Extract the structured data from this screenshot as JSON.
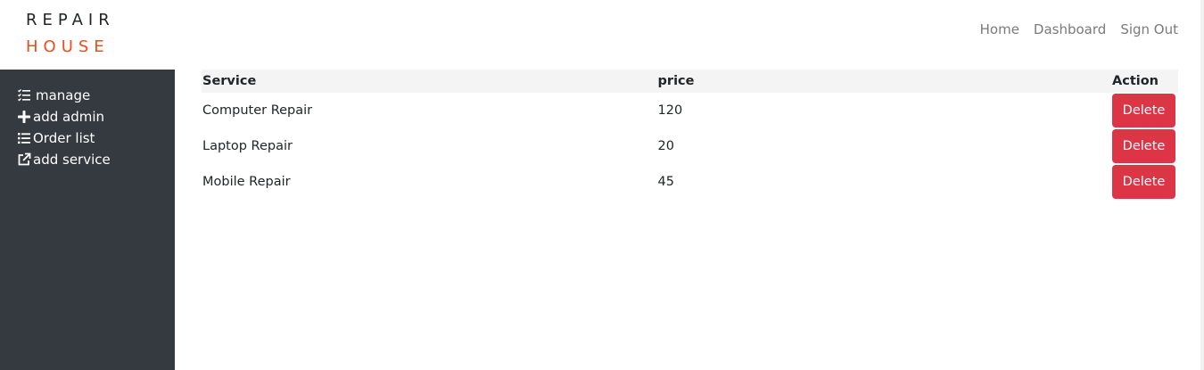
{
  "brand": {
    "line1": "REPAIR",
    "line2": "HOUSE",
    "accent_color": "#f04a1d"
  },
  "topnav": {
    "items": [
      {
        "label": "Home"
      },
      {
        "label": "Dashboard"
      },
      {
        "label": "Sign Out"
      }
    ]
  },
  "sidebar": {
    "background": "#343a40",
    "items": [
      {
        "label": "manage",
        "icon": "checklist-icon"
      },
      {
        "label": "add admin",
        "icon": "plus-icon"
      },
      {
        "label": "Order list",
        "icon": "list-icon"
      },
      {
        "label": "add service",
        "icon": "external-link-icon"
      }
    ]
  },
  "table": {
    "headers": {
      "service": "Service",
      "price": "price",
      "action": "Action"
    },
    "rows": [
      {
        "service": "Computer Repair",
        "price": "120",
        "action_label": "Delete"
      },
      {
        "service": "Laptop Repair",
        "price": "20",
        "action_label": "Delete"
      },
      {
        "service": "Mobile Repair",
        "price": "45",
        "action_label": "Delete"
      }
    ],
    "delete_color": "#dc3545"
  }
}
